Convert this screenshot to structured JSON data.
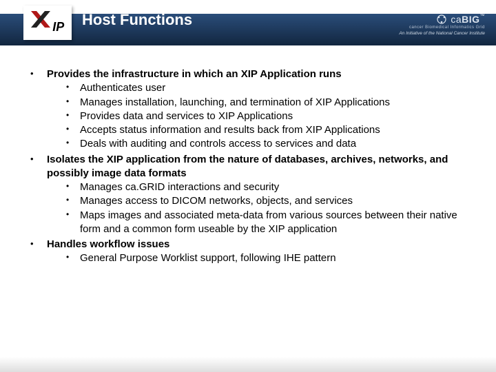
{
  "header": {
    "title": "Host Functions",
    "logo_ip": "IP",
    "brand_prefix": "ca",
    "brand_main": "BIG",
    "brand_sub": "cancer Biomedical Informatics Grid",
    "brand_tag": "An Initiative of the National Cancer Institute",
    "tm": "™"
  },
  "bullets": [
    {
      "lead": "Provides the infrastructure in which an XIP Application runs",
      "sub": [
        "Authenticates user",
        "Manages installation, launching, and termination of XIP Applications",
        "Provides data and services to XIP Applications",
        "Accepts status information and results back from XIP Applications",
        "Deals with auditing and controls access to services and data"
      ]
    },
    {
      "lead": "Isolates the XIP application from the nature of databases, archives, networks, and possibly image data formats",
      "sub": [
        "Manages ca.GRID interactions and security",
        "Manages access to DICOM networks, objects, and services",
        "Maps images and associated meta-data from various sources between their native form and a common form useable by the XIP application"
      ]
    },
    {
      "lead": "Handles workflow issues",
      "sub": [
        "General Purpose Worklist support, following IHE pattern"
      ]
    }
  ]
}
